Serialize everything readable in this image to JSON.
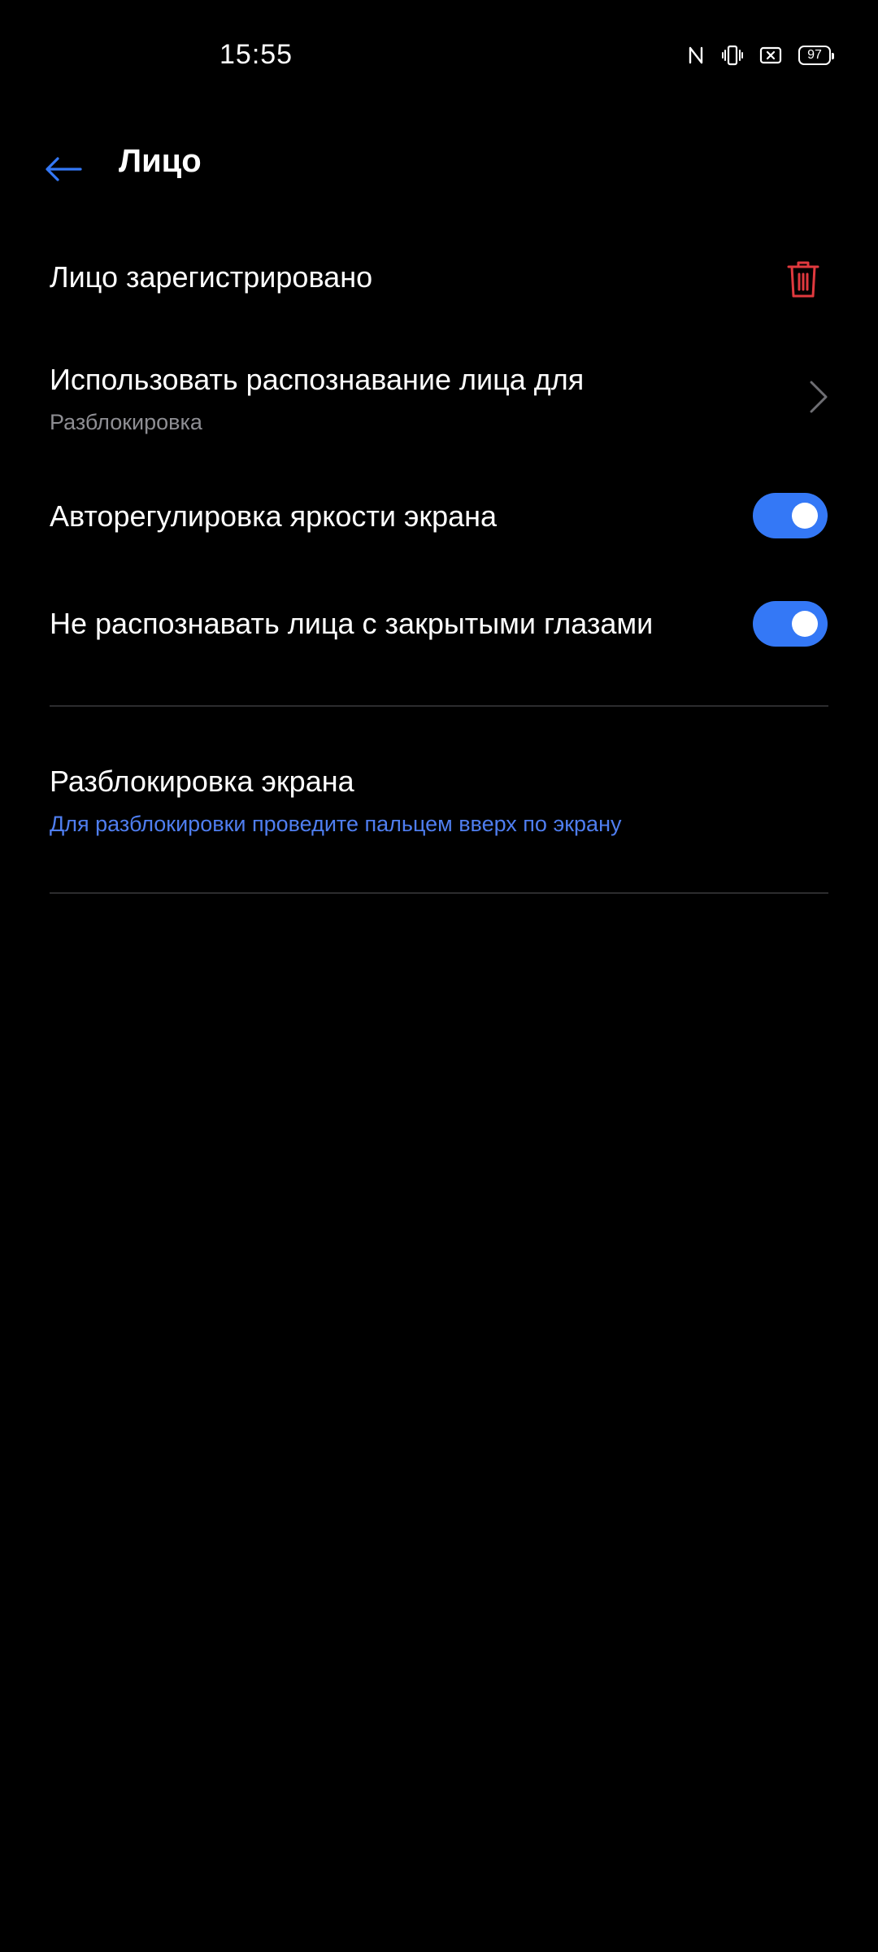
{
  "status_bar": {
    "time": "15:55",
    "icons": [
      "nfc-icon",
      "vibrate-icon",
      "no-sim-icon",
      "battery-icon"
    ],
    "battery_level": "97"
  },
  "header": {
    "back_icon": "arrow-left-icon",
    "title": "Лицо"
  },
  "face_registered": {
    "title": "Лицо зарегистрировано",
    "action_icon": "trash-icon"
  },
  "use_face_for": {
    "title": "Использовать распознавание лица для",
    "subtitle": "Разблокировка",
    "icon": "chevron-right-icon"
  },
  "auto_brightness": {
    "title": "Авторегулировка яркости экрана",
    "enabled": true
  },
  "eyes_closed": {
    "title": "Не распознавать лица с закрытыми глазами",
    "enabled": true
  },
  "screen_unlock": {
    "title": "Разблокировка экрана",
    "subtitle": "Для разблокировки проведите пальцем вверх по экрану"
  },
  "colors": {
    "background": "#000000",
    "accent": "#3478f6",
    "accent_text": "#4f7ef0",
    "delete": "#e0393e",
    "secondary_text": "#8e8e93",
    "divider": "#2c2c2e"
  }
}
